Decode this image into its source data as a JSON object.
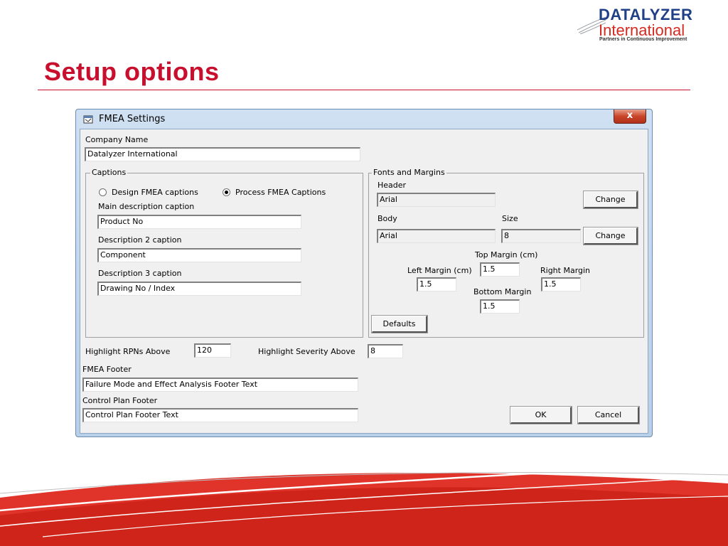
{
  "slide": {
    "title": "Setup options",
    "logo_line1": "DATALYZER",
    "logo_line2": "International",
    "logo_tagline": "Partners in Continuous Improvement"
  },
  "colors": {
    "accent": "#c8102e",
    "brand_blue": "#1f3f86"
  },
  "window": {
    "title": "FMEA Settings",
    "close_glyph": "x",
    "company": {
      "label": "Company Name",
      "value": "Datalyzer International"
    },
    "captions": {
      "group_label": "Captions",
      "radio_design": "Design FMEA captions",
      "radio_process": "Process FMEA Captions",
      "selected": "Process FMEA Captions",
      "main_label": "Main description caption",
      "main_value": "Product No",
      "desc2_label": "Description 2 caption",
      "desc2_value": "Component",
      "desc3_label": "Description 3 caption",
      "desc3_value": "Drawing No / Index"
    },
    "fonts": {
      "group_label": "Fonts and Margins",
      "header_label": "Header",
      "header_value": "Arial",
      "change_label": "Change",
      "body_label": "Body",
      "body_value": "Arial",
      "size_label": "Size",
      "size_value": "8",
      "top_label": "Top Margin (cm)",
      "top_value": "1.5",
      "left_label": "Left Margin (cm)",
      "left_value": "1.5",
      "right_label": "Right Margin",
      "right_value": "1.5",
      "bottom_label": "Bottom Margin",
      "bottom_value": "1.5",
      "defaults_label": "Defaults"
    },
    "highlight_rpn_label": "Highlight RPNs Above",
    "highlight_rpn_value": "120",
    "highlight_sev_label": "Highlight Severity Above",
    "highlight_sev_value": "8",
    "fmea_footer_label": "FMEA Footer",
    "fmea_footer_value": "Failure Mode and Effect Analysis Footer Text",
    "cp_footer_label": "Control Plan Footer",
    "cp_footer_value": "Control Plan Footer Text",
    "ok_label": "OK",
    "cancel_label": "Cancel"
  }
}
